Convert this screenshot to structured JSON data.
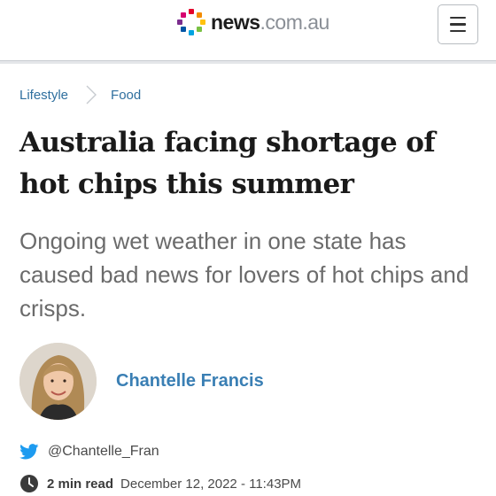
{
  "header": {
    "logo_news": "news",
    "logo_tld": ".com.au"
  },
  "breadcrumb": {
    "items": [
      "Lifestyle",
      "Food"
    ]
  },
  "article": {
    "headline": "Australia facing shortage of hot chips this summer",
    "standfirst": "Ongoing wet weather in one state has caused bad news for lovers of hot chips and crisps."
  },
  "author": {
    "name": "Chantelle Francis",
    "twitter": "@Chantelle_Fran"
  },
  "meta": {
    "read_time": "2 min read",
    "date": "December 12, 2022 - 11:43PM"
  },
  "colors": {
    "link_blue": "#2f6f9e",
    "author_blue": "#3a7fb4",
    "twitter_blue": "#1d9bf0"
  }
}
